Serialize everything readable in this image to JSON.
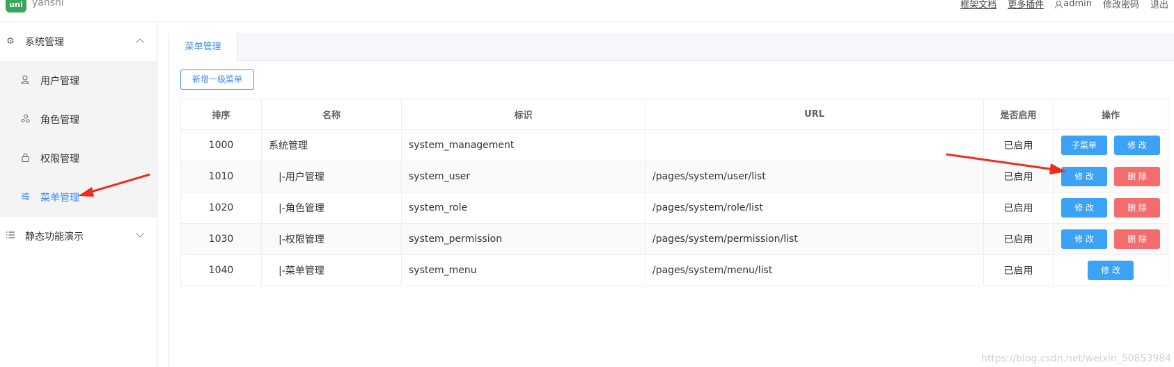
{
  "app": {
    "logo_text": "uni",
    "name": "yanshi"
  },
  "topbar": {
    "links": [
      "框架文档",
      "更多插件"
    ],
    "user": "admin",
    "change_password": "修改密码",
    "logout": "退出"
  },
  "sidebar": {
    "groups": [
      {
        "label": "系统管理",
        "icon": "gear-icon",
        "expanded": true,
        "items": [
          {
            "label": "用户管理",
            "icon": "user-icon"
          },
          {
            "label": "角色管理",
            "icon": "role-icon"
          },
          {
            "label": "权限管理",
            "icon": "lock-icon"
          },
          {
            "label": "菜单管理",
            "icon": "sliders-icon",
            "active": true
          }
        ]
      },
      {
        "label": "静态功能演示",
        "icon": "list-icon",
        "expanded": false
      }
    ]
  },
  "main": {
    "tab": "菜单管理",
    "add_button": "新增一级菜单",
    "table": {
      "headers": [
        "排序",
        "名称",
        "标识",
        "URL",
        "是否启用",
        "操作"
      ],
      "rows": [
        {
          "order": "1000",
          "name": "系统管理",
          "id": "system_management",
          "url": "",
          "enabled": "已启用",
          "actions": [
            "子菜单",
            "修 改"
          ]
        },
        {
          "order": "1010",
          "name": "|-用户管理",
          "id": "system_user",
          "url": "/pages/system/user/list",
          "enabled": "已启用",
          "actions": [
            "修 改",
            "删 除"
          ]
        },
        {
          "order": "1020",
          "name": "|-角色管理",
          "id": "system_role",
          "url": "/pages/system/role/list",
          "enabled": "已启用",
          "actions": [
            "修 改",
            "删 除"
          ]
        },
        {
          "order": "1030",
          "name": "|-权限管理",
          "id": "system_permission",
          "url": "/pages/system/permission/list",
          "enabled": "已启用",
          "actions": [
            "修 改",
            "删 除"
          ]
        },
        {
          "order": "1040",
          "name": "|-菜单管理",
          "id": "system_menu",
          "url": "/pages/system/menu/list",
          "enabled": "已启用",
          "actions": [
            "修 改"
          ]
        }
      ]
    }
  },
  "watermark": "https://blog.csdn.net/weixin_50853984",
  "colors": {
    "accent": "#3b8df6",
    "button_blue": "#3ca2f6",
    "button_red": "#f36d6f",
    "annotation_arrow": "#ee2b1e"
  }
}
